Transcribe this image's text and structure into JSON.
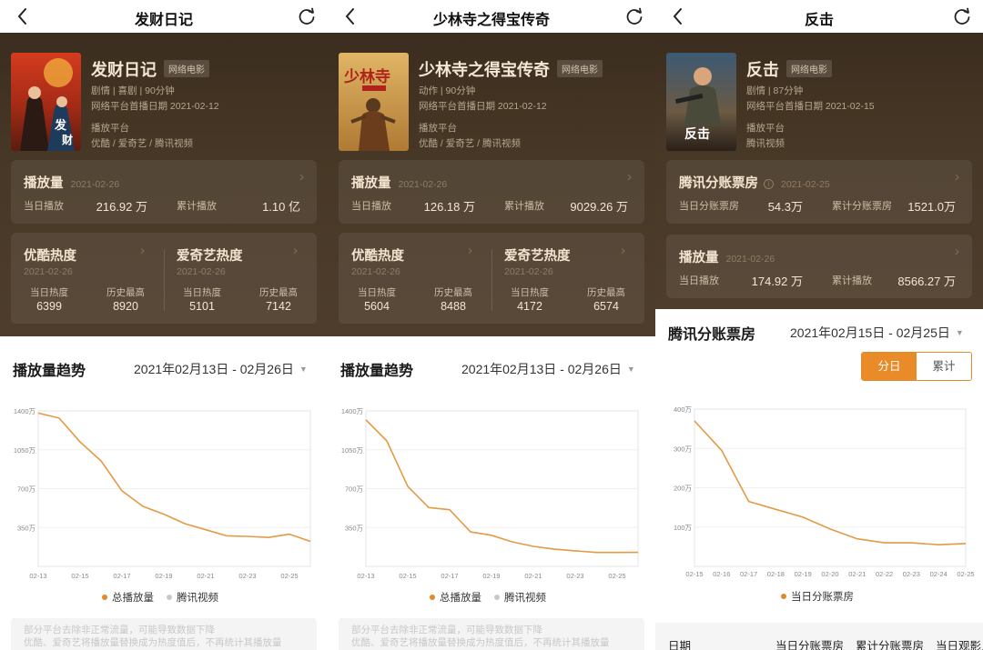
{
  "colors": {
    "accent": "#e08a2c",
    "legend_secondary": "#c8c8c8",
    "hero_bg": "#45362a"
  },
  "icons": {
    "back": "chevron-left-icon",
    "refresh": "refresh-icon"
  },
  "panels": [
    {
      "nav_title": "发财日记",
      "movie": {
        "title": "发财日记",
        "tag": "网络电影",
        "meta1": "剧情 | 喜剧 | 90分钟",
        "meta2": "网络平台首播日期 2021-02-12",
        "platform_label": "播放平台",
        "platforms": "优酷 / 爱奇艺 / 腾讯视频"
      },
      "play_card": {
        "title": "播放量",
        "date": "2021-02-26",
        "daily_label": "当日播放",
        "daily_value": "216.92 万",
        "total_label": "累计播放",
        "total_value": "1.10 亿"
      },
      "heat_cards": [
        {
          "title": "优酷热度",
          "date": "2021-02-26",
          "cur_label": "当日热度",
          "cur_value": "6399",
          "max_label": "历史最高",
          "max_value": "8920"
        },
        {
          "title": "爱奇艺热度",
          "date": "2021-02-26",
          "cur_label": "当日热度",
          "cur_value": "5101",
          "max_label": "历史最高",
          "max_value": "7142"
        }
      ],
      "section_title": "播放量趋势",
      "range": "2021年02月13日 - 02月26日",
      "legend": [
        "总播放量",
        "腾讯视频"
      ],
      "note_lines": [
        "部分平台去除非正常流量，可能导致数据下降",
        "优酷、爱奇艺将播放量替换成为热度值后，不再统计其播放量"
      ]
    },
    {
      "nav_title": "少林寺之得宝传奇",
      "movie": {
        "title": "少林寺之得宝传奇",
        "tag": "网络电影",
        "meta1": "动作 | 90分钟",
        "meta2": "网络平台首播日期 2021-02-12",
        "platform_label": "播放平台",
        "platforms": "优酷 / 爱奇艺 / 腾讯视频"
      },
      "play_card": {
        "title": "播放量",
        "date": "2021-02-26",
        "daily_label": "当日播放",
        "daily_value": "126.18 万",
        "total_label": "累计播放",
        "total_value": "9029.26 万"
      },
      "heat_cards": [
        {
          "title": "优酷热度",
          "date": "2021-02-26",
          "cur_label": "当日热度",
          "cur_value": "5604",
          "max_label": "历史最高",
          "max_value": "8488"
        },
        {
          "title": "爱奇艺热度",
          "date": "2021-02-26",
          "cur_label": "当日热度",
          "cur_value": "4172",
          "max_label": "历史最高",
          "max_value": "6574"
        }
      ],
      "section_title": "播放量趋势",
      "range": "2021年02月13日 - 02月26日",
      "legend": [
        "总播放量",
        "腾讯视频"
      ],
      "note_lines": [
        "部分平台去除非正常流量，可能导致数据下降",
        "优酷、爱奇艺将播放量替换成为热度值后，不再统计其播放量"
      ]
    },
    {
      "nav_title": "反击",
      "movie": {
        "title": "反击",
        "tag": "网络电影",
        "meta1": "剧情 | 87分钟",
        "meta2": "网络平台首播日期 2021-02-15",
        "platform_label": "播放平台",
        "platforms": "腾讯视频"
      },
      "box_card": {
        "title": "腾讯分账票房",
        "date": "2021-02-25",
        "daily_label": "当日分账票房",
        "daily_value": "54.3万",
        "total_label": "累计分账票房",
        "total_value": "1521.0万"
      },
      "play_card": {
        "title": "播放量",
        "date": "2021-02-26",
        "daily_label": "当日播放",
        "daily_value": "174.92 万",
        "total_label": "累计播放",
        "total_value": "8566.27 万"
      },
      "section_title": "腾讯分账票房",
      "range": "2021年02月15日 - 02月25日",
      "toggle": [
        "分日",
        "累计"
      ],
      "legend": [
        "当日分账票房"
      ],
      "table_headers": [
        "日期",
        "当日分账票房",
        "累计分账票房",
        "当日观影人"
      ]
    }
  ],
  "chart_data": [
    {
      "type": "line",
      "categories": [
        "02-13",
        "02-14",
        "02-15",
        "02-16",
        "02-17",
        "02-18",
        "02-19",
        "02-20",
        "02-21",
        "02-22",
        "02-23",
        "02-24",
        "02-25",
        "02-26"
      ],
      "x_tick_labels": [
        "02-13",
        "02-15",
        "02-17",
        "02-19",
        "02-21",
        "02-23",
        "02-25"
      ],
      "y_ticks": [
        "1400万",
        "1050万",
        "700万",
        "350万"
      ],
      "ylim": [
        0,
        1400
      ],
      "series": [
        {
          "name": "总播放量",
          "values": [
            1380,
            1335,
            1120,
            950,
            680,
            540,
            470,
            385,
            330,
            275,
            270,
            260,
            290,
            225
          ]
        }
      ]
    },
    {
      "type": "line",
      "categories": [
        "02-13",
        "02-14",
        "02-15",
        "02-16",
        "02-17",
        "02-18",
        "02-19",
        "02-20",
        "02-21",
        "02-22",
        "02-23",
        "02-24",
        "02-25",
        "02-26"
      ],
      "x_tick_labels": [
        "02-13",
        "02-15",
        "02-17",
        "02-19",
        "02-21",
        "02-23",
        "02-25"
      ],
      "y_ticks": [
        "1400万",
        "1050万",
        "700万",
        "350万"
      ],
      "ylim": [
        0,
        1400
      ],
      "series": [
        {
          "name": "总播放量",
          "values": [
            1320,
            1130,
            720,
            530,
            510,
            310,
            280,
            220,
            180,
            155,
            140,
            125,
            125,
            126
          ]
        }
      ]
    },
    {
      "type": "line",
      "categories": [
        "02-15",
        "02-16",
        "02-17",
        "02-18",
        "02-19",
        "02-20",
        "02-21",
        "02-22",
        "02-23",
        "02-24",
        "02-25"
      ],
      "x_tick_labels": [
        "02-15",
        "02-16",
        "02-17",
        "02-18",
        "02-19",
        "02-20",
        "02-21",
        "02-22",
        "02-23",
        "02-24",
        "02-25"
      ],
      "y_ticks": [
        "400万",
        "300万",
        "200万",
        "100万"
      ],
      "ylim": [
        0,
        400
      ],
      "series": [
        {
          "name": "当日分账票房",
          "values": [
            370,
            295,
            165,
            145,
            125,
            95,
            70,
            60,
            60,
            55,
            58
          ]
        }
      ]
    }
  ]
}
